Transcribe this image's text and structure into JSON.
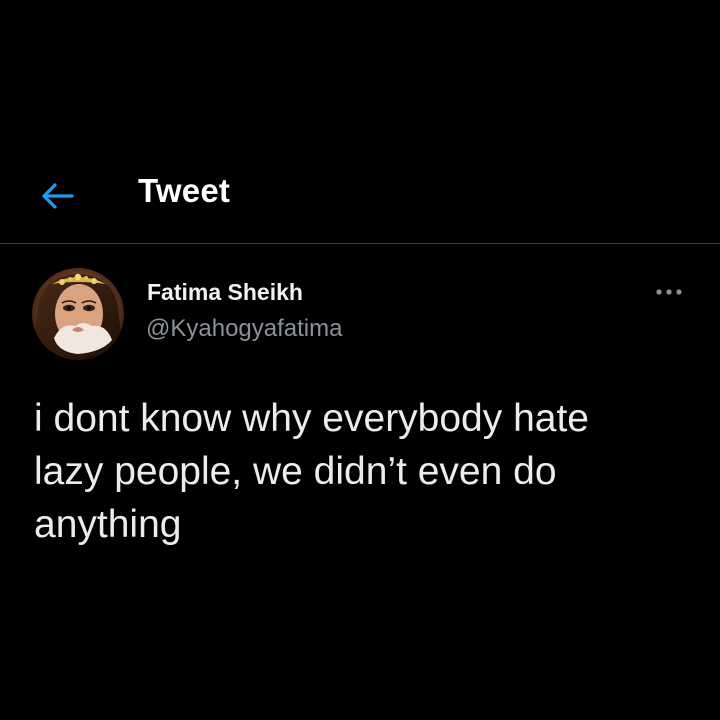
{
  "header": {
    "title": "Tweet",
    "back_icon": "arrow-left-icon"
  },
  "tweet": {
    "author": {
      "name": "Fatima Sheikh",
      "handle": "@Kyahogyafatima",
      "avatar_icon": "profile-photo"
    },
    "more_icon": "ellipsis-icon",
    "text": "i dont know why everybody hate\nlazy people, we didn’t even do\nanything"
  },
  "colors": {
    "background": "#000000",
    "accent": "#1d9bf0",
    "primary_text": "#e7e9ea",
    "secondary_text": "#8b9197",
    "divider": "#3a3d40"
  }
}
